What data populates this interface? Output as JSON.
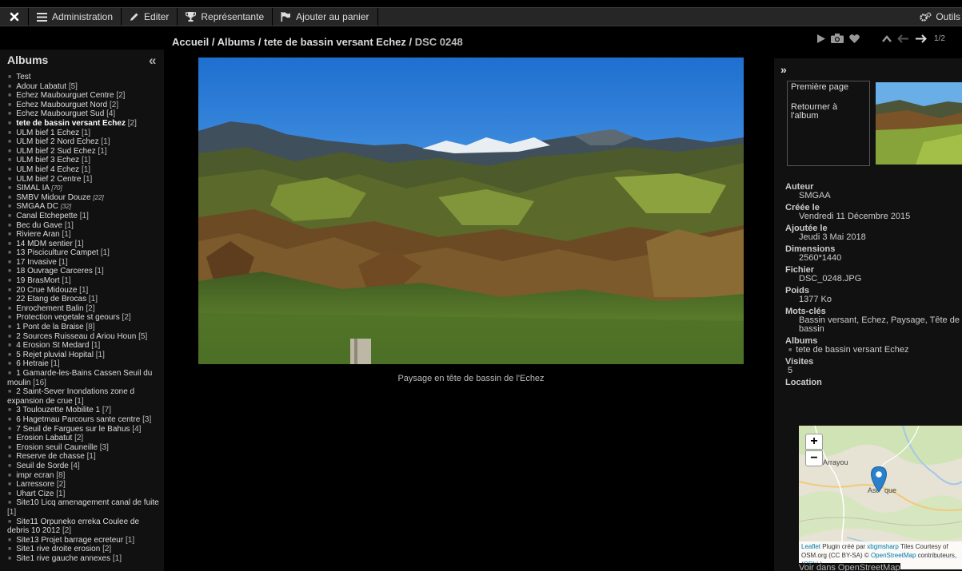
{
  "toolbar": {
    "close_label": "",
    "admin_label": "Administration",
    "edit_label": "Editer",
    "representative_label": "Représentante",
    "cart_label": "Ajouter au panier",
    "tools_label": "Outils"
  },
  "breadcrumb": {
    "home": "Accueil",
    "sep": " / ",
    "albums": "Albums",
    "album": "tete de bassin versant Echez",
    "current": "DSC 0248"
  },
  "pagination": "1/2",
  "sidebar": {
    "title": "Albums",
    "collapse": "«",
    "items": [
      {
        "name": "Test",
        "count": ""
      },
      {
        "name": "Adour Labatut",
        "count": "[5]"
      },
      {
        "name": "Echez Maubourguet Centre",
        "count": "[2]"
      },
      {
        "name": "Echez Maubourguet Nord",
        "count": "[2]"
      },
      {
        "name": "Echez Maubourguet Sud",
        "count": "[4]"
      },
      {
        "name": "tete de bassin versant Echez",
        "count": "[2]"
      },
      {
        "name": "ULM bief 1 Echez",
        "count": "[1]"
      },
      {
        "name": "ULM bief 2 Nord Echez",
        "count": "[1]"
      },
      {
        "name": "ULM bief 2 Sud Echez",
        "count": "[1]"
      },
      {
        "name": "ULM bief 3 Echez",
        "count": "[1]"
      },
      {
        "name": "ULM bief 4 Echez",
        "count": "[1]"
      },
      {
        "name": "ULM bief 2 Centre",
        "count": "[1]"
      },
      {
        "name": "SIMAL IA",
        "count": "[70]"
      },
      {
        "name": "SMBV Midour Douze",
        "count": "[22]"
      },
      {
        "name": "SMGAA DC",
        "count": "[32]"
      },
      {
        "name": "Canal Etchepette",
        "count": "[1]"
      },
      {
        "name": "Bec du Gave",
        "count": "[1]"
      },
      {
        "name": "Riviere Aran",
        "count": "[1]"
      },
      {
        "name": "14 MDM sentier",
        "count": "[1]"
      },
      {
        "name": "13 Pisciculture Campet",
        "count": "[1]"
      },
      {
        "name": "17 Invasive",
        "count": "[1]"
      },
      {
        "name": "18 Ouvrage Carceres",
        "count": "[1]"
      },
      {
        "name": "19 BrasMort",
        "count": "[1]"
      },
      {
        "name": "20 Crue Midouze",
        "count": "[1]"
      },
      {
        "name": "22 Etang de Brocas",
        "count": "[1]"
      },
      {
        "name": "Enrochement Balin",
        "count": "[2]"
      },
      {
        "name": "Protection vegetale st geours",
        "count": "[2]"
      },
      {
        "name": "1 Pont de la Braise",
        "count": "[8]"
      },
      {
        "name": "2 Sources Ruisseau d Ariou Houn",
        "count": "[5]"
      },
      {
        "name": "4 Erosion St Medard",
        "count": "[1]"
      },
      {
        "name": "5 Rejet pluvial Hopital",
        "count": "[1]"
      },
      {
        "name": "6 Hetraie",
        "count": "[1]"
      },
      {
        "name": "1 Gamarde-les-Bains Cassen Seuil du moulin",
        "count": "[16]"
      },
      {
        "name": "2 Saint-Sever Inondations zone d expansion de crue",
        "count": "[1]"
      },
      {
        "name": "3 Toulouzette Mobilite 1",
        "count": "[7]"
      },
      {
        "name": "6 Hagetmau Parcours sante centre",
        "count": "[3]"
      },
      {
        "name": "7 Seuil de Fargues sur le Bahus",
        "count": "[4]"
      },
      {
        "name": "Erosion Labatut",
        "count": "[2]"
      },
      {
        "name": "Erosion seuil Cauneille",
        "count": "[3]"
      },
      {
        "name": "Reserve de chasse",
        "count": "[1]"
      },
      {
        "name": "Seuil de Sorde",
        "count": "[4]"
      },
      {
        "name": "impr ecran",
        "count": "[8]"
      },
      {
        "name": "Larressore",
        "count": "[2]"
      },
      {
        "name": "Uhart Cize",
        "count": "[1]"
      },
      {
        "name": "Site10 Licq amenagement canal de fuite",
        "count": "[1]"
      },
      {
        "name": "Site11 Orpuneko erreka Coulee de debris 10 2012",
        "count": "[2]"
      },
      {
        "name": "Site13 Projet barrage ecreteur",
        "count": "[1]"
      },
      {
        "name": "Site1 rive droite erosion",
        "count": "[2]"
      },
      {
        "name": "Site1 rive gauche annexes",
        "count": "[1]"
      }
    ]
  },
  "image": {
    "caption": "Paysage en tête de bassin de l'Echez"
  },
  "info": {
    "expand": "»",
    "nav_first": "Première page",
    "nav_back": "Retourner à l'album",
    "author_label": "Auteur",
    "author": "SMGAA",
    "created_label": "Créée le",
    "created": "Vendredi 11 Décembre 2015",
    "added_label": "Ajoutée le",
    "added": "Jeudi 3 Mai 2018",
    "dimensions_label": "Dimensions",
    "dimensions": "2560*1440",
    "file_label": "Fichier",
    "file": "DSC_0248.JPG",
    "weight_label": "Poids",
    "weight": "1377 Ko",
    "keywords_label": "Mots-clés",
    "keywords": "Bassin versant, Echez, Paysage, Tête de bassin",
    "albums_label": "Albums",
    "album": "tete de bassin versant Echez",
    "visits_label": "Visites",
    "visits": "5",
    "location_label": "Location",
    "map": {
      "zoom_in": "+",
      "zoom_out": "−",
      "place1": "Arrayou",
      "place2": "Ast",
      "place3": "que",
      "place4": "s",
      "attrib_leaflet": "Leaflet",
      "attrib_plugin": " Plugin créé par ",
      "attrib_author": "xbgmsharp",
      "attrib_tiles": " Tiles Courtesy of OSM.org (CC BY-SA) © ",
      "attrib_osm": "OpenStreetMap",
      "attrib_contrib": " contributeurs, (",
      "attrib_odbl": "ODbL",
      "attrib_end": ")"
    },
    "osm_link": "Voir dans OpenStreetMap"
  },
  "colors": {
    "background": "#000000",
    "toolbar": "#262626",
    "panel": "#111111",
    "link_blue": "#0078a8",
    "marker": "#2a81cb"
  }
}
